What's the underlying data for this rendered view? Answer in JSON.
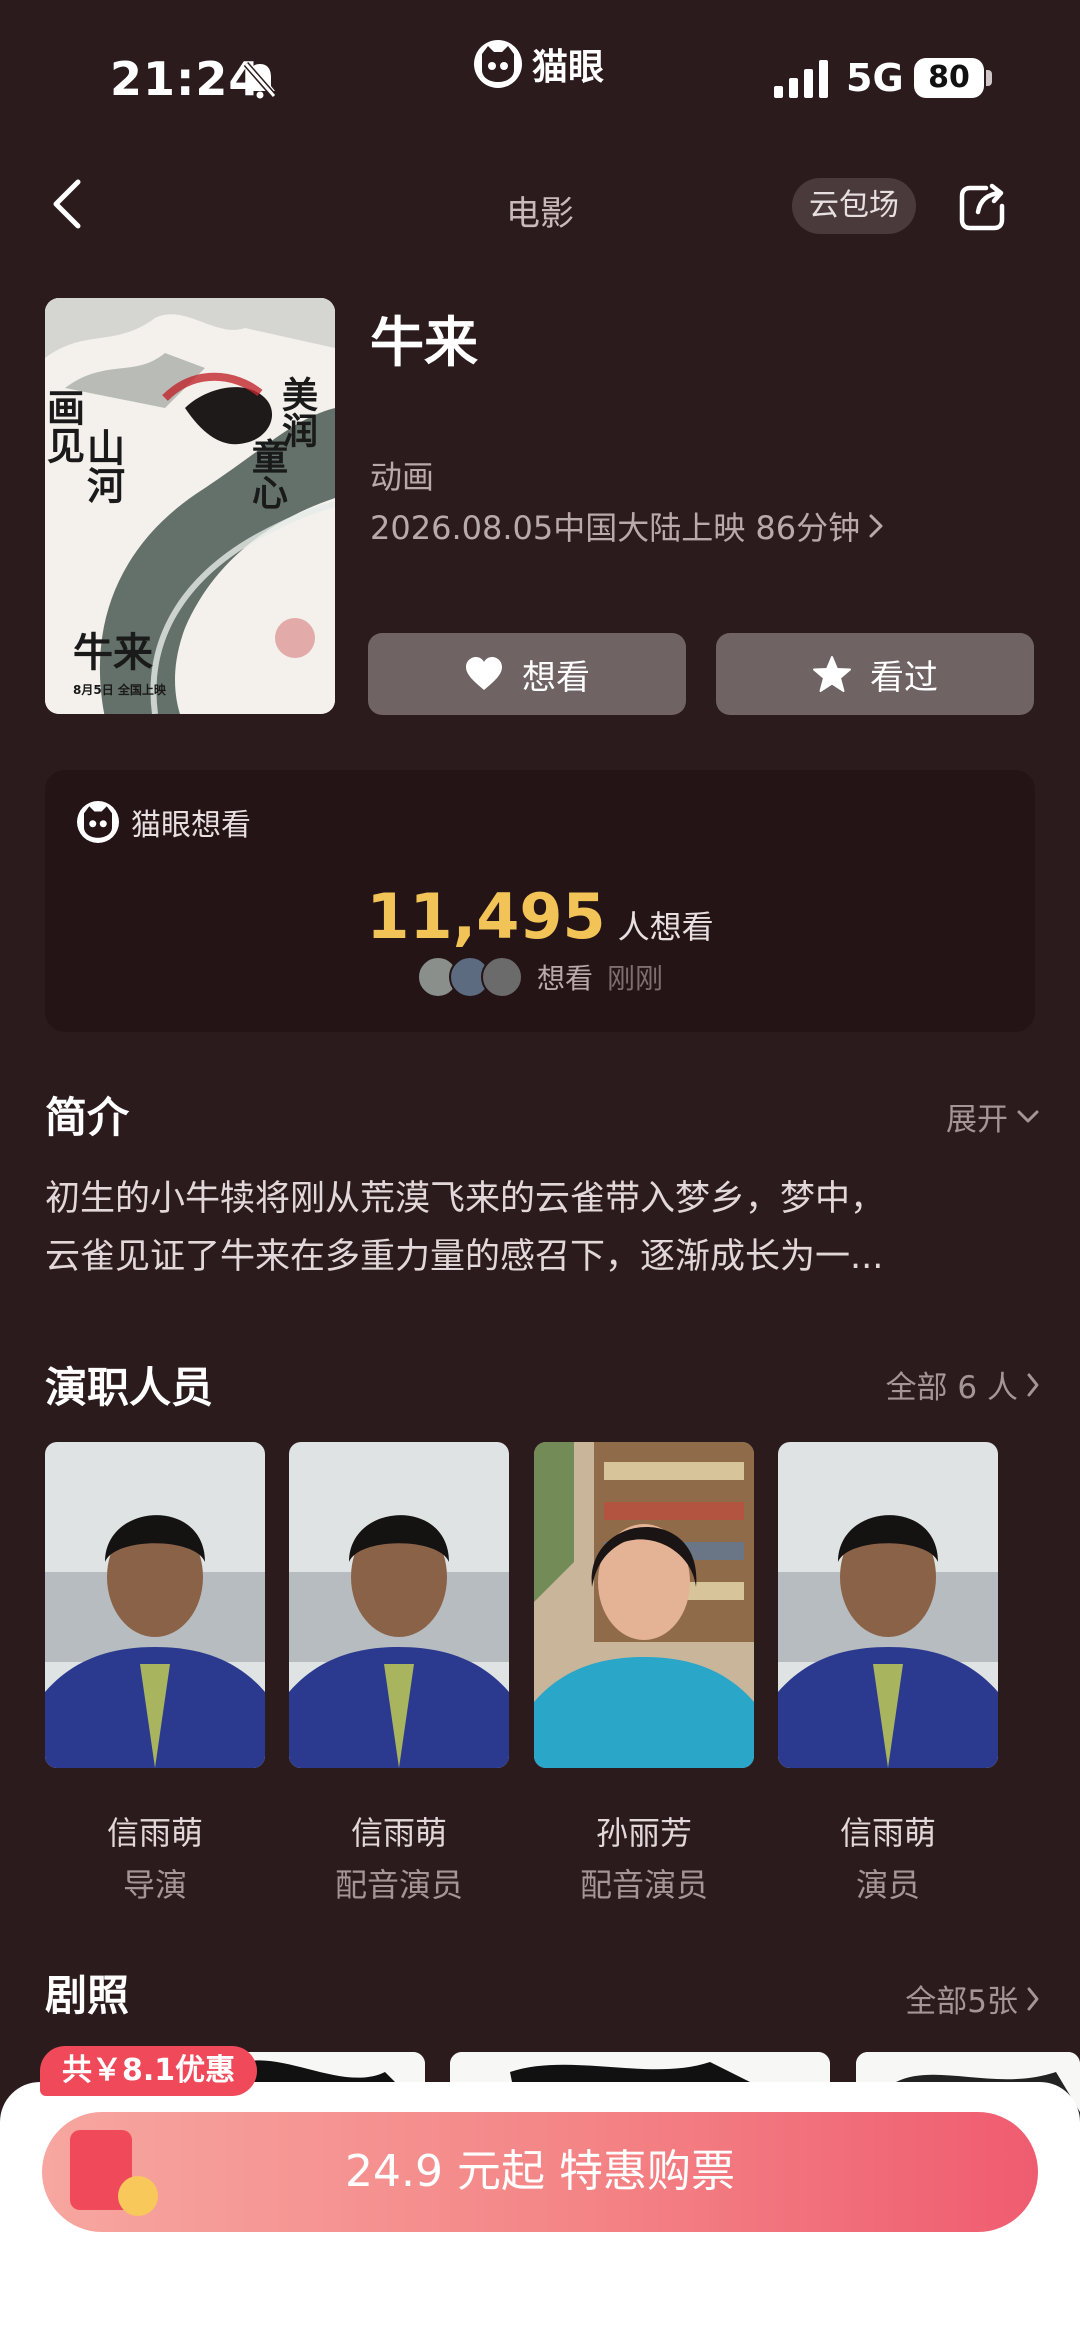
{
  "status_bar": {
    "time": "21:24",
    "network": "5G",
    "battery": "80",
    "app_name": "猫眼"
  },
  "nav": {
    "title": "电影",
    "cloud_button": "云包场"
  },
  "movie": {
    "title": "牛来",
    "genre": "动画",
    "release": "2026.08.05中国大陆上映 86分钟",
    "want_button": "想看",
    "seen_button": "看过",
    "poster_text": {
      "left_calligraphy": "画见山河",
      "right_calligraphy": "美润童心",
      "bottom_title": "牛来",
      "date_line": "8月5日 全国上映"
    }
  },
  "want_card": {
    "title": "猫眼想看",
    "count": "11,495",
    "count_unit": "人想看",
    "activity_label": "想看",
    "activity_time": "刚刚"
  },
  "intro": {
    "title": "简介",
    "expand_label": "展开",
    "text_line1": "初生的小牛犊将刚从荒漠飞来的云雀带入梦乡，梦中，",
    "text_line2": "云雀见证了牛来在多重力量的感召下，逐渐成长为一..."
  },
  "cast": {
    "title": "演职人员",
    "more_label": "全部 6 人",
    "members": [
      {
        "name": "信雨萌",
        "role": "导演"
      },
      {
        "name": "信雨萌",
        "role": "配音演员"
      },
      {
        "name": "孙丽芳",
        "role": "配音演员"
      },
      {
        "name": "信雨萌",
        "role": "演员"
      }
    ]
  },
  "stills": {
    "title": "剧照",
    "more_label": "全部5张"
  },
  "buy": {
    "discount_badge": "共￥8.1优惠",
    "button_label": "24.9 元起  特惠购票"
  },
  "colors": {
    "background": "#2c1b1d",
    "accent_count": "#f2c457",
    "buy_gradient_end": "#ef5c70",
    "discount_badge": "#f04a5a"
  }
}
